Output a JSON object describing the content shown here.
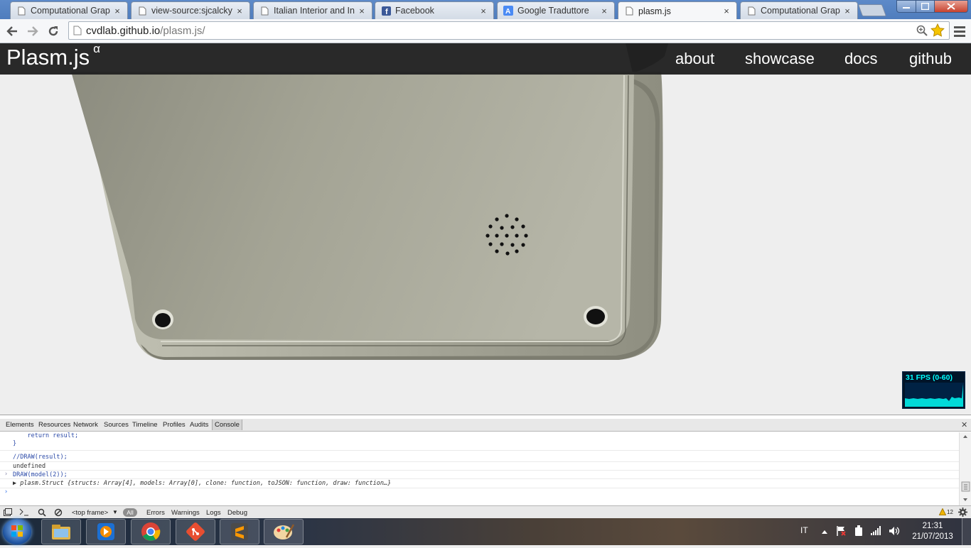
{
  "browser": {
    "tabs": [
      {
        "title": "Computational Graph",
        "icon": "page-icon"
      },
      {
        "title": "view-source:sjcalcky.g",
        "icon": "page-icon"
      },
      {
        "title": "Italian Interior and Ind",
        "icon": "page-icon"
      },
      {
        "title": "Facebook",
        "icon": "facebook-icon"
      },
      {
        "title": "Google Traduttore",
        "icon": "translate-icon"
      },
      {
        "title": "plasm.js",
        "icon": "page-icon"
      },
      {
        "title": "Computational Graph",
        "icon": "page-icon"
      }
    ],
    "active_tab_index": 5,
    "tab_close_glyph": "×",
    "url_host": "cvdlab.github.io",
    "url_path": "/plasm.js/"
  },
  "site": {
    "brand": "Plasm.js",
    "brand_sup": "α",
    "nav": [
      "about",
      "showcase",
      "docs",
      "github"
    ]
  },
  "fps": {
    "label": "31 FPS (0-60)"
  },
  "devtools": {
    "tabs": [
      "Elements",
      "Resources",
      "Network",
      "Sources",
      "Timeline",
      "Profiles",
      "Audits",
      "Console"
    ],
    "selected_tab": "Console",
    "console_lines": {
      "l1": "    return result;",
      "l2": "}",
      "l3": "//DRAW(result);",
      "l4": "undefined",
      "l5": "DRAW(model(2));",
      "l6": "▶ plasm.Struct {structs: Array[4], models: Array[0], clone: function, toJSON: function, draw: function…}"
    },
    "status": {
      "frame": "<top frame>",
      "all": "All",
      "filters": [
        "Errors",
        "Warnings",
        "Logs",
        "Debug"
      ],
      "warning_count": "12"
    }
  },
  "taskbar": {
    "apps": [
      "explorer-icon",
      "media-player-icon",
      "chrome-icon",
      "git-icon",
      "sublime-text-icon",
      "paint-icon"
    ],
    "language": "IT",
    "time": "21:31",
    "date": "21/07/2013"
  }
}
